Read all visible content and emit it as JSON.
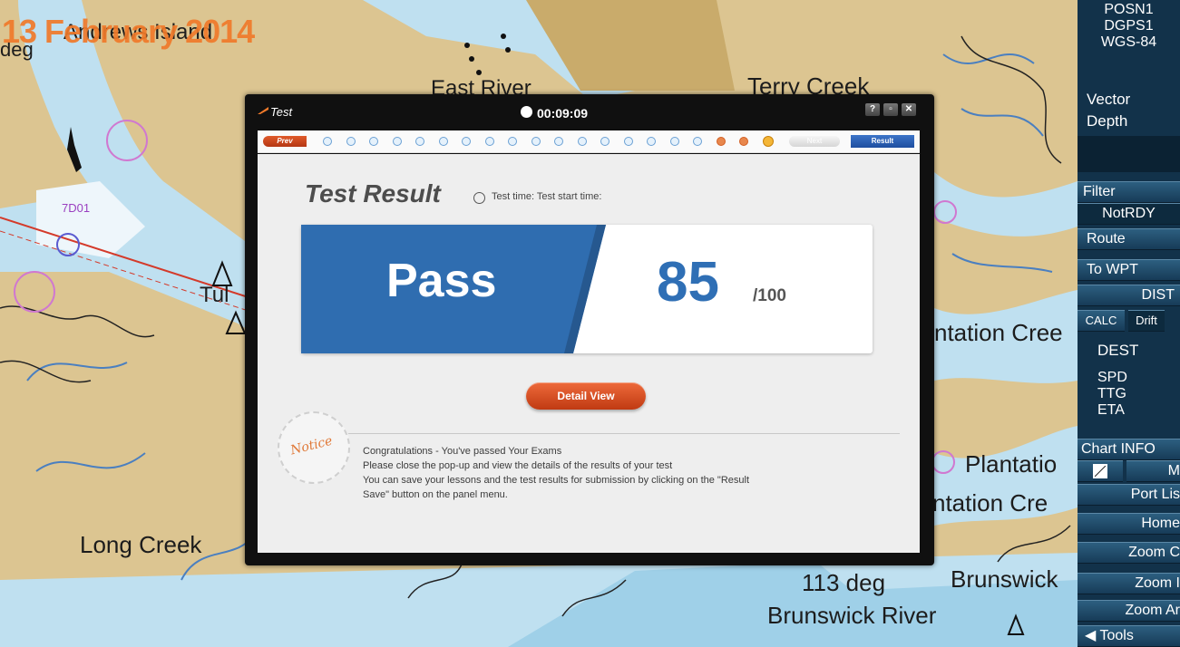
{
  "overlay_date": "13 February 2014",
  "map_labels": {
    "island": "Andrews Island",
    "east_river": "East River",
    "terry_creek": "Terry Creek",
    "long_creek": "Long Creek",
    "plantation_creek_1": "ntation Cree",
    "plantation_2": "Plantatio",
    "plantation_creek_3": "ntation Cre",
    "brunswick": "Brunswick",
    "brunswick_river": "Brunswick River",
    "heading": "113 deg",
    "deg_left": "deg",
    "tul": "Tul",
    "code": "7D01"
  },
  "panel": {
    "posn": "POSN1",
    "dgps": "DGPS1",
    "datum": "WGS-84",
    "vector": "Vector",
    "depth": "Depth",
    "filter": "Filter",
    "notrdy": "NotRDY",
    "route": "Route",
    "to_wpt": "To WPT",
    "dist": "DIST",
    "calc": "CALC",
    "drift": "Drift",
    "dest": "DEST",
    "spd": "SPD",
    "ttg": "TTG",
    "eta": "ETA",
    "chart_info": "Chart INFO",
    "m": "M",
    "port_list": "Port Lis",
    "home": "Home",
    "zoom_c": "Zoom C",
    "zoom_i": "Zoom I",
    "zoom_a": "Zoom Ar",
    "tools": "Tools"
  },
  "dialog": {
    "title": "Test",
    "timer": "00:09:09",
    "prev_label": "Prev",
    "next_label": "Next",
    "result_label": "Result",
    "heading": "Test Result",
    "test_time_label": "Test time:  Test start time:",
    "pass_label": "Pass",
    "score": "85",
    "score_max": "/100",
    "detail_button": "Detail View",
    "notice": "Notice",
    "messages": [
      "Congratulations - You've passed Your Exams",
      "Please close the pop-up and view the details of the results of your test",
      "You can save your lessons and the test results for submission by clicking on the \"Result",
      "Save\" button on the panel menu."
    ]
  },
  "colors": {
    "accent": "#f07a2a",
    "pass_blue": "#2f6fb5",
    "land": "#dcc591",
    "water": "#bfe0f0"
  }
}
